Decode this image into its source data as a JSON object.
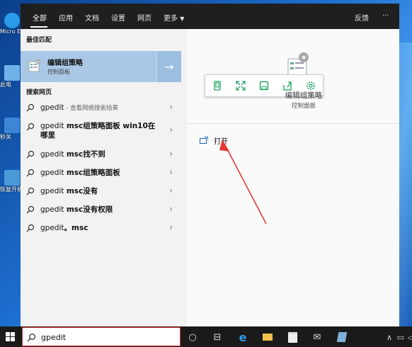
{
  "menu": {
    "tabs": [
      {
        "label": "全部"
      },
      {
        "label": "应用"
      },
      {
        "label": "文档"
      },
      {
        "label": "设置"
      },
      {
        "label": "网页"
      },
      {
        "label": "更多"
      }
    ],
    "feedback_label": "反馈",
    "more_options_label": "···"
  },
  "best_match": {
    "heading": "最佳匹配",
    "title": "编辑组策略",
    "subtitle": "控制面板"
  },
  "web_search": {
    "heading": "搜索网页",
    "items": [
      {
        "query": "gpedit",
        "suffix": "",
        "hint": " - 查看网络搜索结果"
      },
      {
        "query": "gpedit ",
        "suffix": "msc组策略面板 win10在哪里",
        "hint": ""
      },
      {
        "query": "gpedit ",
        "suffix": "msc找不到",
        "hint": ""
      },
      {
        "query": "gpedit ",
        "suffix": "msc组策略面板",
        "hint": ""
      },
      {
        "query": "gpedit ",
        "suffix": "msc没有",
        "hint": ""
      },
      {
        "query": "gpedit ",
        "suffix": "msc没有权限",
        "hint": ""
      },
      {
        "query": "gpedit",
        "suffix": "。msc",
        "hint": ""
      }
    ]
  },
  "detail": {
    "title": "编辑组策略",
    "subtitle": "控制面板",
    "open_label": "打开"
  },
  "desktop": {
    "icons": [
      {
        "label": "Micro Edg"
      },
      {
        "label": "此电"
      },
      {
        "label": "秒关"
      },
      {
        "label": "恢复开机"
      }
    ]
  },
  "taskbar": {
    "search_value": "gpedit"
  },
  "colors": {
    "best_match_bg": "#aac8e6",
    "toolbar_icon": "#16a05a",
    "annotation_arrow": "#e53935",
    "search_highlight": "#dd3333"
  }
}
